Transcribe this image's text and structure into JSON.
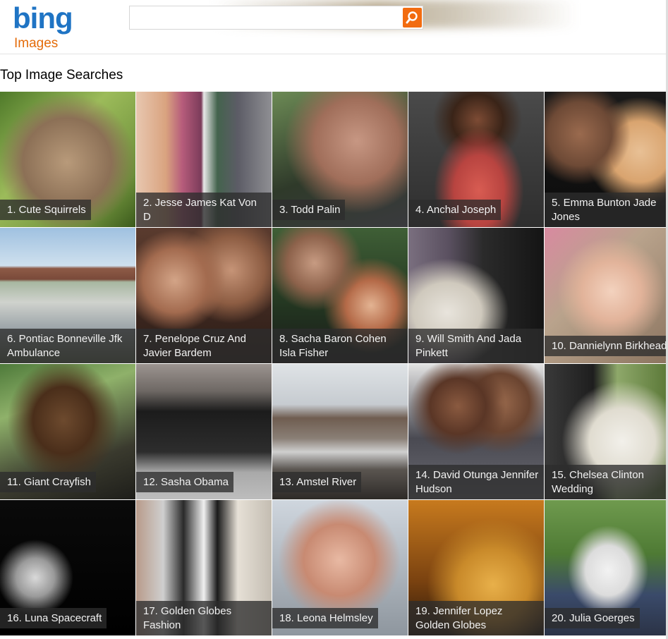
{
  "header": {
    "logo_text": "bing",
    "vertical_label": "Images",
    "search_placeholder": "",
    "accent_color": "#f26c10",
    "logo_color": "#1f74c4",
    "search_icon": "magnifier-icon"
  },
  "section_title": "Top Image Searches",
  "tiles": [
    {
      "caption": "1. Cute Squirrels"
    },
    {
      "caption": "2. Jesse James Kat Von D"
    },
    {
      "caption": "3. Todd Palin"
    },
    {
      "caption": "4. Anchal Joseph"
    },
    {
      "caption": "5. Emma Bunton Jade Jones"
    },
    {
      "caption": "6. Pontiac Bonneville Jfk Ambulance"
    },
    {
      "caption": "7. Penelope Cruz And Javier Bardem"
    },
    {
      "caption": "8. Sacha Baron Cohen Isla Fisher"
    },
    {
      "caption": "9. Will Smith And Jada Pinkett"
    },
    {
      "caption": "10. Dannielynn Birkhead"
    },
    {
      "caption": "11. Giant Crayfish"
    },
    {
      "caption": "12. Sasha Obama"
    },
    {
      "caption": "13. Amstel River"
    },
    {
      "caption": "14. David Otunga Jennifer Hudson"
    },
    {
      "caption": "15. Chelsea Clinton Wedding"
    },
    {
      "caption": "16. Luna Spacecraft"
    },
    {
      "caption": "17. Golden Globes Fashion"
    },
    {
      "caption": "18. Leona Helmsley"
    },
    {
      "caption": "19. Jennifer Lopez Golden Globes"
    },
    {
      "caption": "20. Julia Goerges"
    }
  ]
}
